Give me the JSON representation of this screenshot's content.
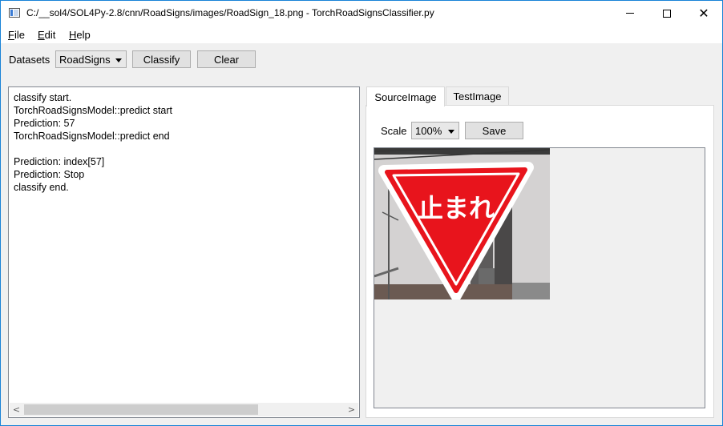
{
  "window": {
    "title": "C:/__sol4/SOL4Py-2.8/cnn/RoadSigns/images/RoadSign_18.png - TorchRoadSignsClassifier.py",
    "minimize_glyph": "",
    "close_glyph": "✕"
  },
  "menu": {
    "file": {
      "u": "F",
      "rest": "ile"
    },
    "edit": {
      "u": "E",
      "rest": "dit"
    },
    "help": {
      "u": "H",
      "rest": "elp"
    }
  },
  "toolbar": {
    "datasets_label": "Datasets",
    "dataset_selected": "RoadSigns",
    "classify_label": "Classify",
    "clear_label": "Clear"
  },
  "log": {
    "lines": [
      "classify start.",
      "TorchRoadSignsModel::predict start",
      "Prediction: 57",
      "TorchRoadSignsModel::predict end",
      "",
      "Prediction: index[57]",
      "Prediction: Stop",
      "classify end."
    ]
  },
  "scroll": {
    "left": "<",
    "right": ">"
  },
  "tabs": [
    {
      "label": "SourceImage",
      "active": true
    },
    {
      "label": "TestImage",
      "active": false
    }
  ],
  "image_panel": {
    "scale_label": "Scale",
    "scale_selected": "100%",
    "save_label": "Save"
  },
  "photo": {
    "sign_text": "止まれ",
    "sign_color": "#e8141c",
    "sky_color": "#d4d2d2"
  },
  "colors": {
    "window_border": "#1883d7",
    "panel_bg": "#f0f0f0"
  }
}
